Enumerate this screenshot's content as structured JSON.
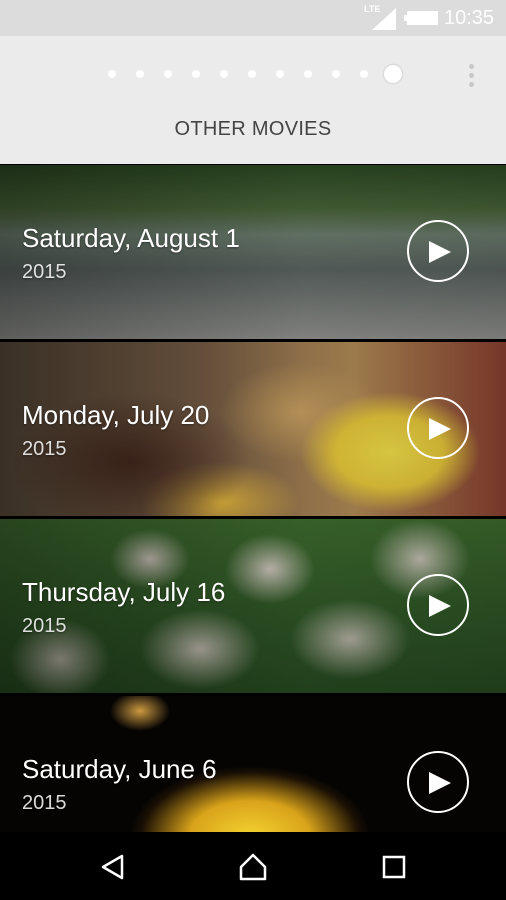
{
  "status_bar": {
    "network": "LTE",
    "time": "10:35"
  },
  "pager": {
    "total_pages": 11,
    "active_index": 10
  },
  "section": {
    "title": "OTHER MOVIES"
  },
  "movies": [
    {
      "date": "Saturday, August 1",
      "year": "2015",
      "thumbnail": "river-scene"
    },
    {
      "date": "Monday, July 20",
      "year": "2015",
      "thumbnail": "food-plate"
    },
    {
      "date": "Thursday, July 16",
      "year": "2015",
      "thumbnail": "white-flowers"
    },
    {
      "date": "Saturday, June 6",
      "year": "2015",
      "thumbnail": "candle-jar"
    }
  ],
  "icons": {
    "play": "play-icon",
    "overflow": "more-vert-icon",
    "nav_back": "back-icon",
    "nav_home": "home-icon",
    "nav_recents": "recents-icon"
  },
  "colors": {
    "header_bg": "#ebebeb",
    "status_bar_bg": "#dcdcdc",
    "nav_bar_bg": "#000000",
    "title_text": "#444444"
  }
}
